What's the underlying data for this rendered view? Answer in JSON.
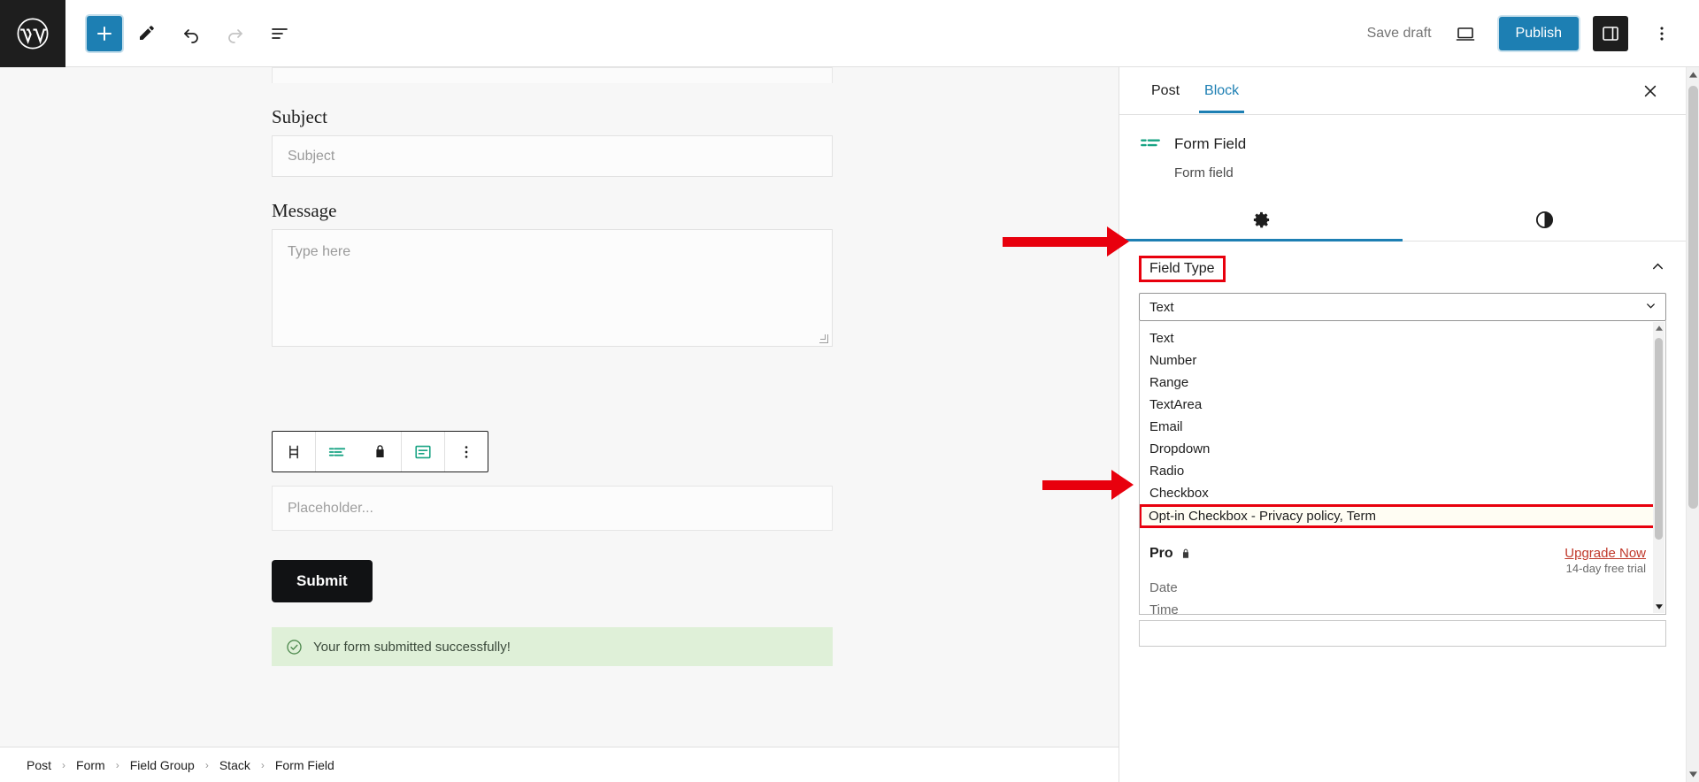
{
  "topbar": {
    "logo_icon": "wordpress-logo-icon",
    "add_block_icon": "plus-icon",
    "tools_icon": "pencil-edit-icon",
    "undo_icon": "undo-arrow-icon",
    "redo_icon": "redo-arrow-icon",
    "list_view_icon": "list-view-icon",
    "save_draft_label": "Save draft",
    "preview_icon": "desktop-preview-icon",
    "publish_label": "Publish",
    "sidebar_toggle_icon": "settings-sidebar-icon",
    "options_icon": "vertical-ellipsis-icon",
    "accent_blue": "#1d7fb3"
  },
  "canvas": {
    "fields": [
      {
        "label": "Subject",
        "placeholder": "Subject"
      },
      {
        "label": "Message",
        "placeholder": "Type here"
      }
    ],
    "selected_field_placeholder": "Placeholder...",
    "submit_label": "Submit",
    "success_message": "Your form submitted successfully!",
    "success_icon": "check-circle-icon",
    "success_bg": "#dff0d8"
  },
  "block_toolbar": {
    "drag_icon": "drag-handle-icon",
    "form_field_icon": "form-field-icon",
    "lock_icon": "lock-icon",
    "align_icon": "align-text-icon",
    "more_icon": "vertical-ellipsis-icon",
    "accent_teal": "#18a383"
  },
  "breadcrumb": {
    "items": [
      "Post",
      "Form",
      "Field Group",
      "Stack",
      "Form Field"
    ],
    "separator": "›"
  },
  "sidebar": {
    "tabs": [
      {
        "label": "Post",
        "active": false
      },
      {
        "label": "Block",
        "active": true
      }
    ],
    "close_icon": "close-x-icon",
    "block": {
      "icon": "form-field-icon",
      "title": "Form Field",
      "description": "Form field"
    },
    "subtabs": [
      {
        "icon": "gear-settings-icon",
        "active": true
      },
      {
        "icon": "styles-contrast-icon",
        "active": false
      }
    ],
    "field_type_panel": {
      "title": "Field Type",
      "collapse_icon": "chevron-up-icon",
      "select_value": "Text",
      "select_chevron_icon": "chevron-down-icon",
      "options": [
        "Text",
        "Number",
        "Range",
        "TextArea",
        "Email",
        "Dropdown",
        "Radio",
        "Checkbox"
      ],
      "highlighted_option": "Opt-in Checkbox - Privacy policy, Term",
      "pro": {
        "label": "Pro",
        "lock_icon": "lock-icon",
        "upgrade_label": "Upgrade Now",
        "trial_label": "14-day free trial",
        "locked_options": [
          "Date",
          "Time"
        ],
        "link_color": "#c0392b"
      },
      "scroll_up_icon": "scroll-up-arrow-icon",
      "scroll_down_icon": "scroll-down-arrow-icon"
    }
  },
  "annotations": {
    "color": "#e8000d",
    "arrows": [
      {
        "target": "Field Type"
      },
      {
        "target": "Opt-in Checkbox - Privacy policy, Term"
      }
    ]
  }
}
